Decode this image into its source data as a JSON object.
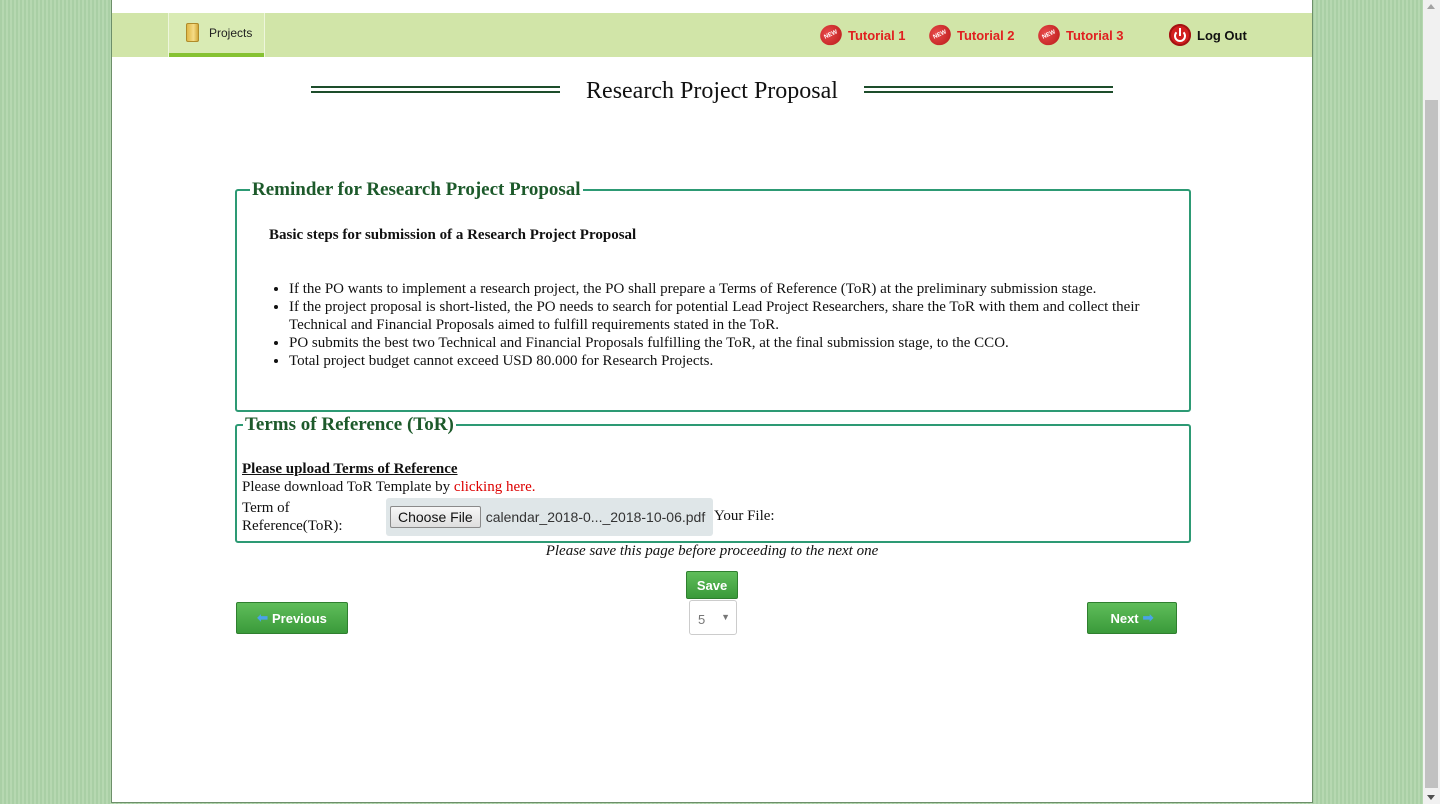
{
  "nav": {
    "projects_label": "Projects",
    "tutorials": [
      "Tutorial 1",
      "Tutorial 2",
      "Tutorial 3"
    ],
    "new_badge": "NEW",
    "logout_label": "Log Out"
  },
  "page_title": "Research Project Proposal",
  "reminder": {
    "legend": "Reminder for Research Project Proposal",
    "subtitle": "Basic steps for submission of a Research Project Proposal",
    "steps": [
      "If the PO wants to implement a research project, the PO shall prepare a Terms of Reference (ToR) at the preliminary submission stage.",
      "If the project proposal is short-listed, the PO needs to search for potential Lead Project Researchers, share the ToR with them and collect their Technical and Financial Proposals aimed to fulfill requirements stated in the ToR.",
      "PO submits the best two Technical and Financial Proposals fulfilling the ToR, at the final submission stage, to the CCO.",
      "Total project budget cannot exceed USD 80.000 for Research Projects."
    ]
  },
  "tor": {
    "legend": "Terms of Reference (ToR)",
    "upload_title": "Please upload Terms of Reference",
    "download_text": "Please download ToR Template by ",
    "download_link": "clicking here.",
    "field_label": "Term of Reference(ToR):",
    "choose_file_label": "Choose File",
    "file_name": "calendar_2018-0..._2018-10-06.pdf",
    "your_file_label": "Your File:"
  },
  "footer": {
    "save_note": "Please save this page before proceeding to the next one",
    "save_label": "Save",
    "previous_label": "Previous",
    "next_label": "Next",
    "page_select_value": "5"
  },
  "colors": {
    "nav_bar": "#d1e5a8",
    "tutorial_text": "#e02020",
    "legend_text": "#1d5a2b",
    "fieldset_border": "#2d9a74",
    "button_green": "#4caf50",
    "link_red": "#dd0000"
  }
}
